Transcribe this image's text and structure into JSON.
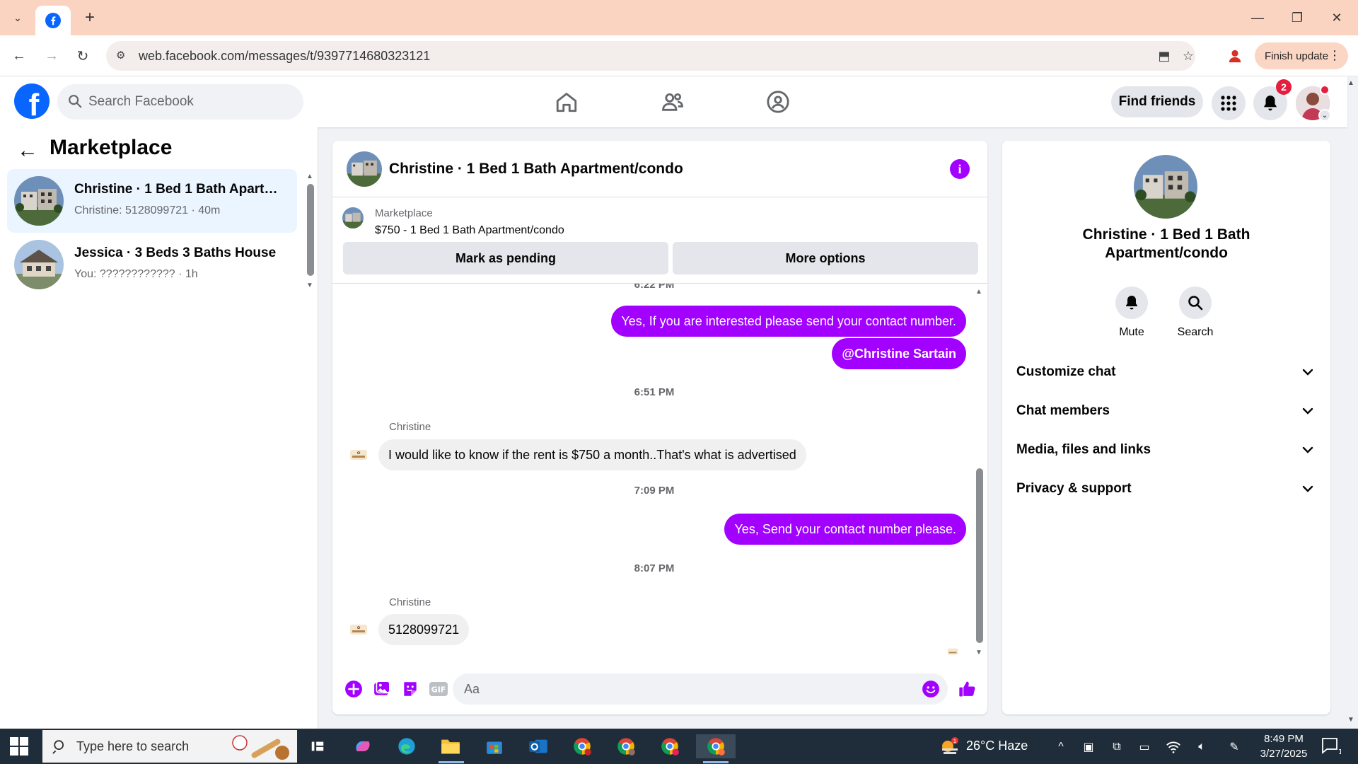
{
  "browser": {
    "url": "web.facebook.com/messages/t/9397714680323121",
    "finish_update": "Finish update"
  },
  "header": {
    "search_placeholder": "Search Facebook",
    "find_friends": "Find friends",
    "notifications_count": "2"
  },
  "left": {
    "title": "Marketplace",
    "conversations": [
      {
        "name": "Christine · 1 Bed 1 Bath Apartme...",
        "sub": "Christine: 5128099721 · 40m"
      },
      {
        "name": "Jessica · 3 Beds 3 Baths House",
        "sub": "You: ???????????? · 1h"
      }
    ]
  },
  "chat": {
    "title": "Christine · 1 Bed 1 Bath Apartment/condo",
    "marketplace_label": "Marketplace",
    "listing": "$750 - 1 Bed 1 Bath Apartment/condo",
    "mark_pending": "Mark as pending",
    "more_options": "More options",
    "messages": [
      {
        "type": "ts",
        "text": "6:22 PM"
      },
      {
        "type": "out",
        "text": "Yes, If you are interested please send your contact number."
      },
      {
        "type": "out",
        "text": "@Christine Sartain"
      },
      {
        "type": "ts",
        "text": "6:51 PM"
      },
      {
        "type": "sender",
        "text": "Christine"
      },
      {
        "type": "in",
        "text": "I would like to know if the rent is $750 a month..That's what is advertised"
      },
      {
        "type": "ts",
        "text": "7:09 PM"
      },
      {
        "type": "out",
        "text": "Yes, Send your contact number please."
      },
      {
        "type": "ts",
        "text": "8:07 PM"
      },
      {
        "type": "sender",
        "text": "Christine"
      },
      {
        "type": "in",
        "text": "5128099721"
      }
    ],
    "composer_placeholder": "Aa",
    "gif_label": "GIF"
  },
  "right": {
    "name": "Christine · 1 Bed 1 Bath Apartment/condo",
    "mute": "Mute",
    "search": "Search",
    "sections": [
      "Customize chat",
      "Chat members",
      "Media, files and links",
      "Privacy & support"
    ]
  },
  "taskbar": {
    "search_placeholder": "Type here to search",
    "weather": "26°C  Haze",
    "time": "8:49 PM",
    "date": "3/27/2025",
    "notif_count": "1"
  },
  "colors": {
    "fb_blue": "#0866ff",
    "message_purple": "#a200ff",
    "tab_bar": "#fad4c0"
  }
}
